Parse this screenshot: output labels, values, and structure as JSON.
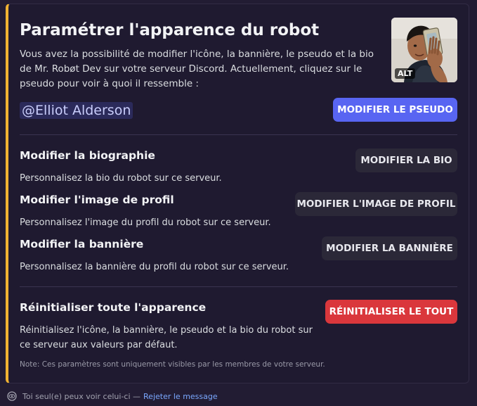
{
  "embed": {
    "accent_color": "#f0b232",
    "title": "Paramétrer l'apparence du robot",
    "description": "Vous avez la possibilité de modifier l'icône, la bannière, le pseudo et la bio de Mr. Robøt Dev sur votre serveur Discord. Actuellement, cliquez sur le pseudo pour voir à quoi il ressemble :",
    "thumbnail": {
      "alt_badge": "ALT"
    },
    "mention": "@Elliot Alderson",
    "rename_button": "MODIFIER LE PSEUDO",
    "sections": [
      {
        "title": "Modifier la biographie",
        "description": "Personnalisez la bio du robot sur ce serveur.",
        "button": "MODIFIER LA BIO"
      },
      {
        "title": "Modifier l'image de profil",
        "description": "Personnalisez l'image du profil du robot sur ce serveur.",
        "button": "MODIFIER L'IMAGE DE PROFIL"
      },
      {
        "title": "Modifier la bannière",
        "description": "Personnalisez la bannière du profil du robot sur ce serveur.",
        "button": "MODIFIER LA BANNIÈRE"
      }
    ],
    "reset": {
      "title": "Réinitialiser toute l'apparence",
      "description": "Réinitialisez l'icône, la bannière, le pseudo et la bio du robot sur ce serveur aux valeurs par défaut.",
      "button": "RÉINITIALISER LE TOUT"
    },
    "note": "Note: Ces paramètres sont uniquement visibles par les membres de votre serveur."
  },
  "footer": {
    "icon": "eye-icon",
    "visibility_text": "Toi seul(e) peux voir celui-ci —",
    "dismiss_link": "Rejeter le message"
  },
  "colors": {
    "primary": "#5865f2",
    "secondary": "#2b2838",
    "danger": "#da373c",
    "link": "#7aa8ff",
    "background": "#221c33"
  }
}
